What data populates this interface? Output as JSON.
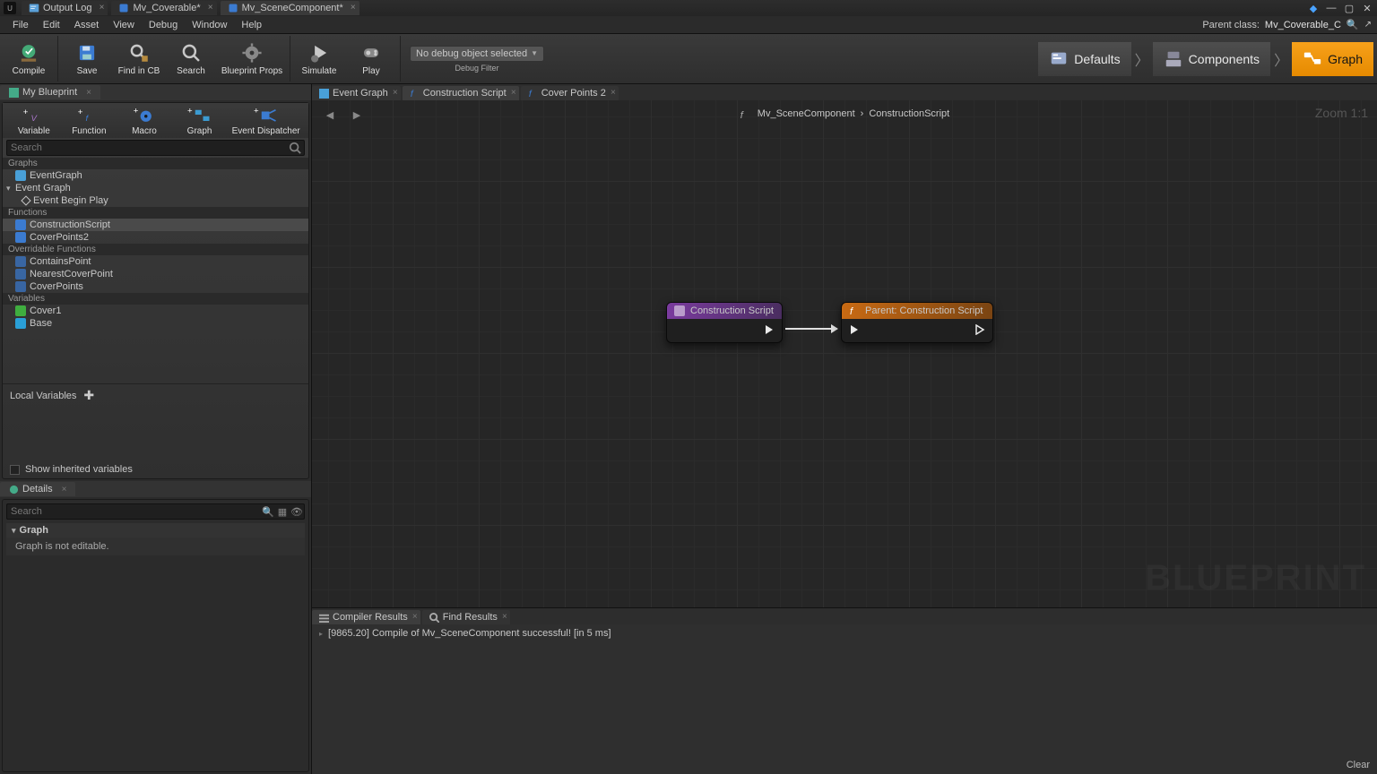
{
  "titletabs": [
    {
      "label": "Output Log"
    },
    {
      "label": "Mv_Coverable*"
    },
    {
      "label": "Mv_SceneComponent*",
      "active": true
    }
  ],
  "menu": [
    "File",
    "Edit",
    "Asset",
    "View",
    "Debug",
    "Window",
    "Help"
  ],
  "parent_class_label": "Parent class:",
  "parent_class": "Mv_Coverable_C",
  "toolbar": {
    "compile": "Compile",
    "save": "Save",
    "find": "Find in CB",
    "search": "Search",
    "props": "Blueprint Props",
    "simulate": "Simulate",
    "play": "Play",
    "debug_filter": "Debug Filter",
    "debug_sel": "No debug object selected"
  },
  "modes": {
    "defaults": "Defaults",
    "components": "Components",
    "graph": "Graph"
  },
  "mybp_tab": "My Blueprint",
  "addrow": {
    "variable": "Variable",
    "function": "Function",
    "macro": "Macro",
    "graph": "Graph",
    "dispatcher": "Event Dispatcher"
  },
  "mybp_search_placeholder": "Search",
  "tree": {
    "graphs_hdr": "Graphs",
    "eventgraph": "EventGraph",
    "eventgraph_cat": "Event Graph",
    "event_begin": "Event Begin Play",
    "functions_hdr": "Functions",
    "construction": "ConstructionScript",
    "cover2": "CoverPoints2",
    "overridable_hdr": "Overridable Functions",
    "contains": "ContainsPoint",
    "nearest": "NearestCoverPoint",
    "coverpoints": "CoverPoints",
    "vars_hdr": "Variables",
    "cover1": "Cover1",
    "base": "Base"
  },
  "local_vars": "Local Variables",
  "show_inherited": "Show inherited variables",
  "details_tab": "Details",
  "details_search_placeholder": "Search",
  "details_cat": "Graph",
  "details_msg": "Graph is not editable.",
  "graph_tabs": [
    {
      "label": "Event Graph",
      "kind": "evt"
    },
    {
      "label": "Construction Script",
      "kind": "fn",
      "active": true
    },
    {
      "label": "Cover Points 2",
      "kind": "fn"
    }
  ],
  "breadcrumb": {
    "a": "Mv_SceneComponent",
    "b": "ConstructionScript"
  },
  "zoom": "Zoom 1:1",
  "watermark": "BLUEPRINT",
  "node1": "Construction Script",
  "node2": "Parent: Construction Script",
  "bottom_tabs": [
    {
      "label": "Compiler Results",
      "active": true
    },
    {
      "label": "Find Results"
    }
  ],
  "compile_msg": "[9865.20] Compile of Mv_SceneComponent successful! [in 5 ms]",
  "clear": "Clear"
}
